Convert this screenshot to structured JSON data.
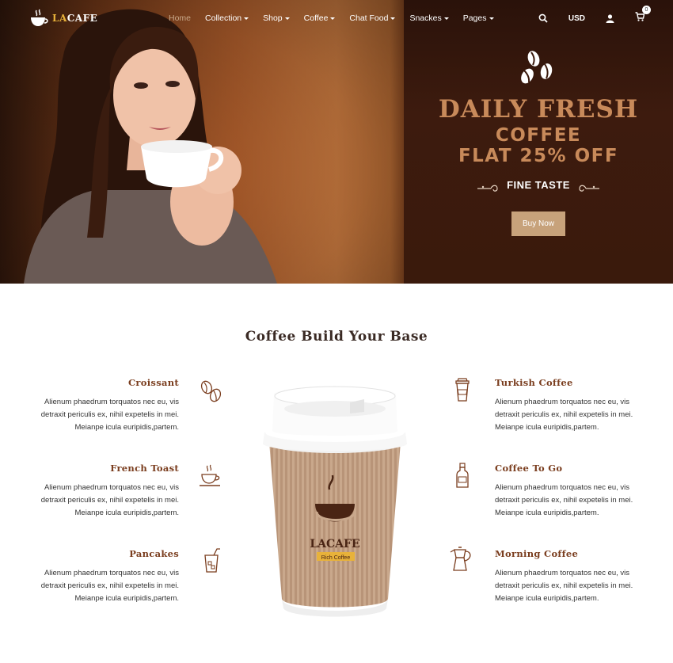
{
  "brand": {
    "logo_text_la": "LA",
    "logo_text_rest": "CAFE"
  },
  "nav": {
    "items": [
      {
        "label": "Home"
      },
      {
        "label": "Collection"
      },
      {
        "label": "Shop"
      },
      {
        "label": "Coffee"
      },
      {
        "label": "Chat Food"
      },
      {
        "label": "Snackes"
      },
      {
        "label": "Pages"
      }
    ],
    "currency": "USD",
    "cart_count": "0"
  },
  "hero": {
    "headline": "DAILY FRESH",
    "line2": "COFFEE",
    "line3": "FLAT 25% OFF",
    "tagline": "FINE TASTE",
    "cta": "Buy Now"
  },
  "section": {
    "title": "Coffee Build Your Base",
    "cup_brand": "LACAFE",
    "cup_sub": "Rich Coffee",
    "left": [
      {
        "title": "Croissant",
        "l1": "Alienum phaedrum torquatos nec eu, vis",
        "l2": "detraxit periculis ex, nihil expetelis in mei.",
        "l3": "Meianpe icula euripidis,partem."
      },
      {
        "title": "French Toast",
        "l1": "Alienum phaedrum torquatos nec eu, vis",
        "l2": "detraxit periculis ex, nihil expetelis in mei.",
        "l3": "Meianpe icula euripidis,partem."
      },
      {
        "title": "Pancakes",
        "l1": "Alienum phaedrum torquatos nec eu, vis",
        "l2": "detraxit periculis ex, nihil expetelis in mei.",
        "l3": "Meianpe icula euripidis,partem."
      }
    ],
    "right": [
      {
        "title": "Turkish Coffee",
        "l1": "Alienum phaedrum torquatos nec eu, vis",
        "l2": "detraxit periculis ex, nihil expetelis in mei.",
        "l3": "Meianpe icula euripidis,partem."
      },
      {
        "title": "Coffee To Go",
        "l1": "Alienum phaedrum torquatos nec eu, vis",
        "l2": "detraxit periculis ex, nihil expetelis in mei.",
        "l3": "Meianpe icula euripidis,partem."
      },
      {
        "title": "Morning Coffee",
        "l1": "Alienum phaedrum torquatos nec eu, vis",
        "l2": "detraxit periculis ex, nihil expetelis in mei.",
        "l3": "Meianpe icula euripidis,partem."
      }
    ]
  },
  "colors": {
    "accent": "#c88a5a",
    "brown_title": "#7a3d1e",
    "button": "#c7a27b"
  }
}
